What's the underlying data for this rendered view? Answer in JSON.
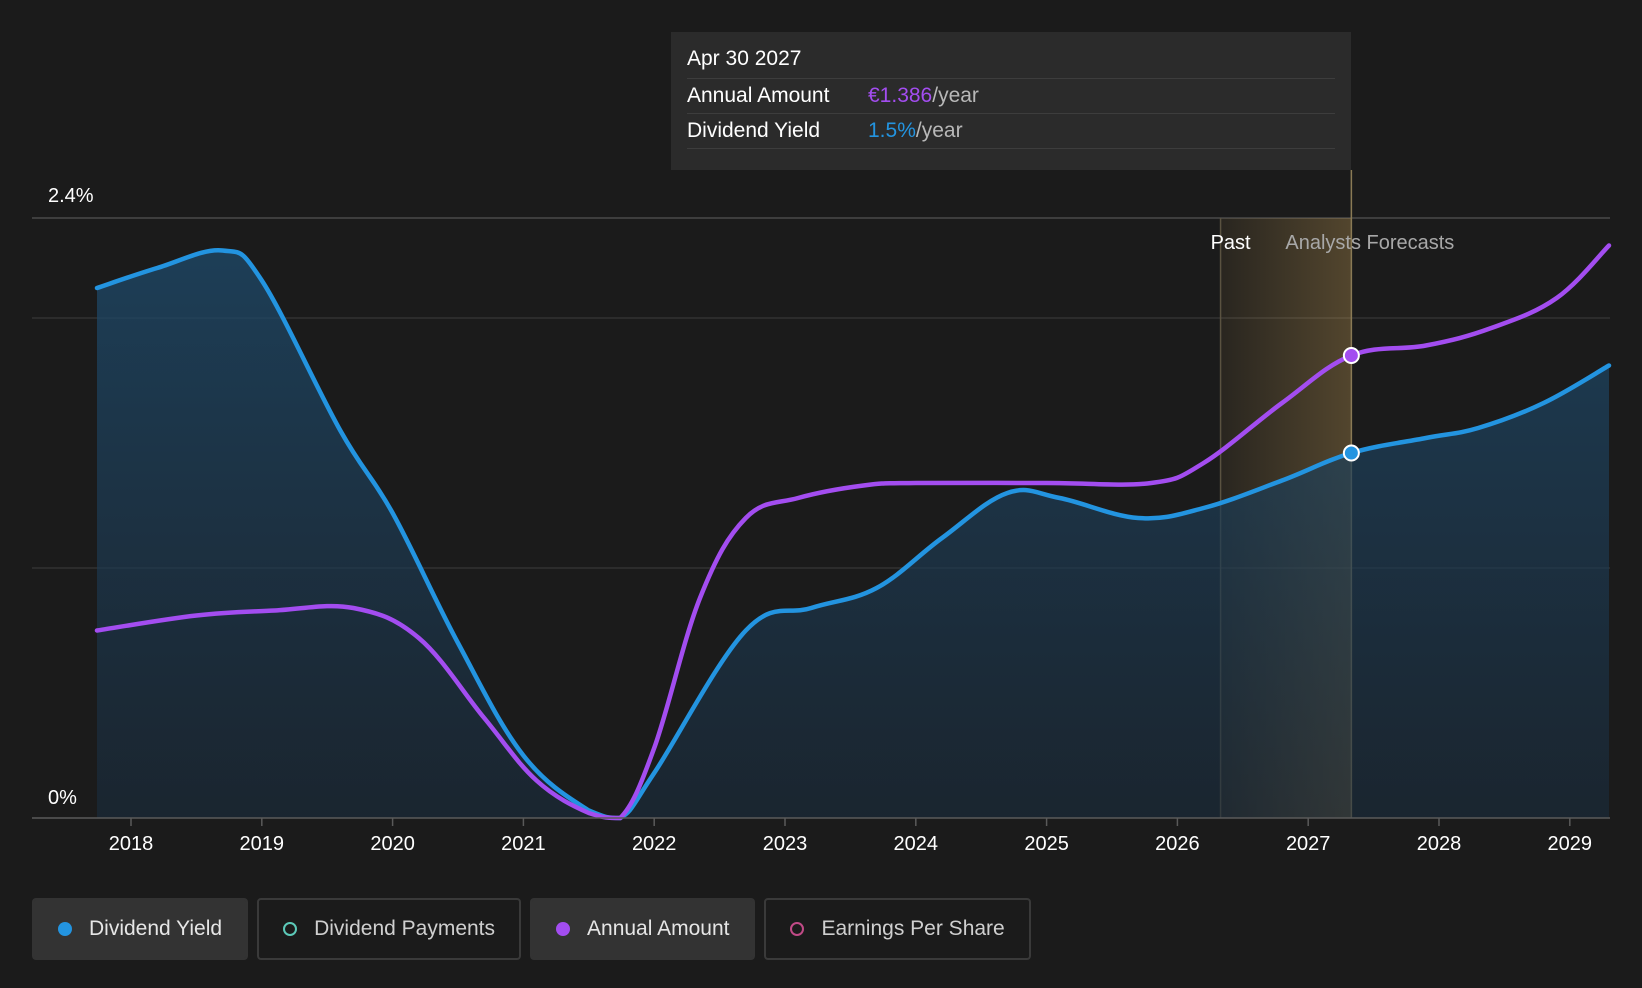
{
  "tooltip": {
    "date": "Apr 30 2027",
    "rows": [
      {
        "label": "Annual Amount",
        "value": "€1.386",
        "unit": "/year",
        "color": "#a34df0"
      },
      {
        "label": "Dividend Yield",
        "value": "1.5%",
        "unit": "/year",
        "color": "#2394e0"
      }
    ]
  },
  "chart_data": {
    "type": "area",
    "title": "",
    "xlabel": "",
    "ylabel": "",
    "x_ticks": [
      "2018",
      "2019",
      "2020",
      "2021",
      "2022",
      "2023",
      "2024",
      "2025",
      "2026",
      "2027",
      "2028",
      "2029"
    ],
    "y_tick_labels": [
      "2.4%",
      "0%"
    ],
    "ylim": [
      0,
      2.4
    ],
    "xlim": [
      2017.4,
      2029.3
    ],
    "grid": true,
    "past_label": "Past",
    "forecast_label": "Analysts Forecasts",
    "past_band": [
      2026.33,
      2027.33
    ],
    "hover_x": 2027.33,
    "series": [
      {
        "name": "Dividend Yield",
        "color": "#2394e0",
        "filled": true,
        "points": [
          [
            2017.74,
            2.12
          ],
          [
            2018.2,
            2.2
          ],
          [
            2018.7,
            2.27
          ],
          [
            2019.0,
            2.15
          ],
          [
            2019.6,
            1.55
          ],
          [
            2020.0,
            1.22
          ],
          [
            2020.5,
            0.7
          ],
          [
            2021.0,
            0.25
          ],
          [
            2021.5,
            0.03
          ],
          [
            2021.74,
            0.0
          ],
          [
            2022.0,
            0.18
          ],
          [
            2022.7,
            0.75
          ],
          [
            2023.2,
            0.84
          ],
          [
            2023.7,
            0.92
          ],
          [
            2024.2,
            1.12
          ],
          [
            2024.7,
            1.3
          ],
          [
            2025.1,
            1.28
          ],
          [
            2025.7,
            1.2
          ],
          [
            2026.2,
            1.24
          ],
          [
            2026.8,
            1.35
          ],
          [
            2027.33,
            1.46
          ],
          [
            2027.9,
            1.52
          ],
          [
            2028.3,
            1.56
          ],
          [
            2028.8,
            1.66
          ],
          [
            2029.3,
            1.81
          ]
        ]
      },
      {
        "name": "Annual Amount",
        "color": "#a34df0",
        "filled": false,
        "points": [
          [
            2017.74,
            0.75
          ],
          [
            2018.5,
            0.81
          ],
          [
            2019.1,
            0.83
          ],
          [
            2019.7,
            0.84
          ],
          [
            2020.2,
            0.72
          ],
          [
            2020.7,
            0.4
          ],
          [
            2021.1,
            0.15
          ],
          [
            2021.5,
            0.02
          ],
          [
            2021.74,
            0.0
          ],
          [
            2022.0,
            0.28
          ],
          [
            2022.35,
            0.88
          ],
          [
            2022.7,
            1.2
          ],
          [
            2023.1,
            1.28
          ],
          [
            2023.6,
            1.33
          ],
          [
            2024.0,
            1.34
          ],
          [
            2025.0,
            1.34
          ],
          [
            2025.8,
            1.34
          ],
          [
            2026.2,
            1.42
          ],
          [
            2026.8,
            1.66
          ],
          [
            2027.33,
            1.85
          ],
          [
            2027.9,
            1.89
          ],
          [
            2028.4,
            1.96
          ],
          [
            2028.9,
            2.08
          ],
          [
            2029.3,
            2.29
          ]
        ]
      }
    ]
  },
  "legend": [
    {
      "label": "Dividend Yield",
      "color": "#2394e0",
      "active": true,
      "filled": true
    },
    {
      "label": "Dividend Payments",
      "color": "#5cc9b8",
      "active": false,
      "filled": false
    },
    {
      "label": "Annual Amount",
      "color": "#a34df0",
      "active": true,
      "filled": true
    },
    {
      "label": "Earnings Per Share",
      "color": "#c04a86",
      "active": false,
      "filled": false
    }
  ]
}
